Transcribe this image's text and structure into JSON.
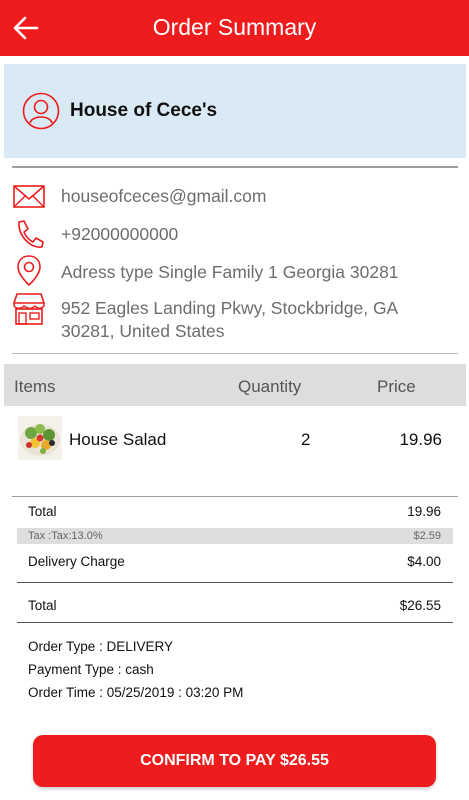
{
  "colors": {
    "accent": "#ee1c1c",
    "store_card_bg": "#d9eaf5",
    "header_bg": "#dddddd"
  },
  "appbar": {
    "title": "Order Summary",
    "back_icon": "arrow-left-icon"
  },
  "store": {
    "name": "House of Cece's",
    "icon": "user-circle-icon"
  },
  "contact": {
    "email": "houseofceces@gmail.com",
    "phone": "+92000000000",
    "address_type": "Adress type Single Family 1 Georgia 30281",
    "address_line1": "952 Eagles Landing Pkwy, Stockbridge, GA",
    "address_line2": "30281, United States"
  },
  "items_table": {
    "headers": {
      "items": "Items",
      "quantity": "Quantity",
      "price": "Price"
    },
    "rows": [
      {
        "name": "House Salad",
        "quantity": "2",
        "price": "19.96"
      }
    ]
  },
  "summary": {
    "total_label": "Total",
    "total_value": "19.96",
    "tax_label": "Tax :Tax:13.0%",
    "tax_value": "$2.59",
    "delivery_label": "Delivery Charge",
    "delivery_value": "$4.00",
    "grand_total_label": "Total",
    "grand_total_value": "$26.55"
  },
  "order_meta": {
    "order_type": "Order Type : DELIVERY",
    "payment_type": "Payment Type : cash",
    "order_time": "Order Time : 05/25/2019 : 03:20 PM"
  },
  "confirm_button": {
    "label": "CONFIRM TO PAY $26.55"
  }
}
